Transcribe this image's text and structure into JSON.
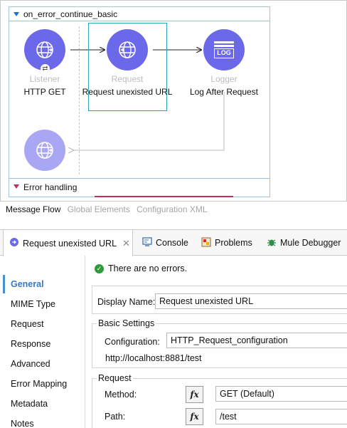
{
  "flow": {
    "name": "on_error_continue_basic",
    "components": [
      {
        "type": "Listener",
        "name": "HTTP GET",
        "icon": "globe-icon"
      },
      {
        "type": "Request",
        "name": "Request unexisted URL",
        "icon": "globe-icon"
      },
      {
        "type": "Logger",
        "name": "Log After Request",
        "icon": "log-icon"
      }
    ],
    "logger_icon_text": "LOG",
    "error_handling_label": "Error handling"
  },
  "canvas_tabs": [
    {
      "label": "Message Flow",
      "active": true
    },
    {
      "label": "Global Elements",
      "active": false
    },
    {
      "label": "Configuration XML",
      "active": false
    }
  ],
  "view_tabs": [
    {
      "label": "Request unexisted URL",
      "icon": "request-icon"
    },
    {
      "label": "Console",
      "icon": "console-icon"
    },
    {
      "label": "Problems",
      "icon": "problems-icon"
    },
    {
      "label": "Mule Debugger",
      "icon": "debugger-icon"
    }
  ],
  "nav": [
    "General",
    "MIME Type",
    "Request",
    "Response",
    "Advanced",
    "Error Mapping",
    "Metadata",
    "Notes"
  ],
  "status": "There are no errors.",
  "form": {
    "display_name_label": "Display Name:",
    "display_name_value": "Request unexisted URL",
    "basic_settings_title": "Basic Settings",
    "configuration_label": "Configuration:",
    "configuration_value": "HTTP_Request_configuration",
    "config_url": "http://localhost:8881/test",
    "request_title": "Request",
    "method_label": "Method:",
    "method_value": "GET (Default)",
    "path_label": "Path:",
    "path_value": "/test",
    "fx_label": "fx"
  },
  "colors": {
    "processor_dark": "#6b68ea",
    "processor_light": "#a9a6f3",
    "selection": "#2aa8b8",
    "error_line": "#c0305a",
    "nav_active": "#3a78c4"
  }
}
